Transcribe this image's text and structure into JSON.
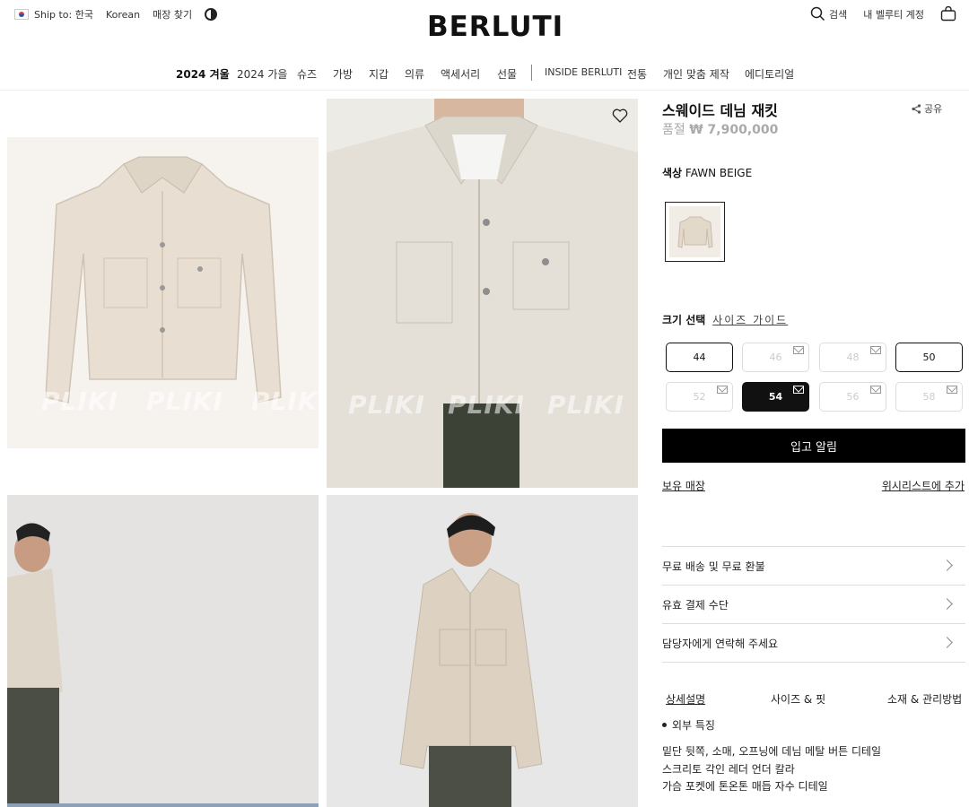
{
  "topbar": {
    "ship_to": "Ship to: 한국",
    "language": "Korean",
    "store_finder": "매장 찾기",
    "logo": "BERLUTI",
    "search": "검색",
    "account": "내 벨루티 계정"
  },
  "nav": {
    "items": [
      "2024 겨울",
      "2024 가을",
      "슈즈",
      "가방",
      "지갑",
      "의류",
      "액세서리",
      "선물",
      "INSIDE BERLUTI",
      "전통",
      "개인 맞춤 제작",
      "에디토리얼"
    ]
  },
  "gallery": {
    "watermark": "PLIKI"
  },
  "product": {
    "name": "스웨이드 데님 재킷",
    "share": "공유",
    "price_status": "품절",
    "price": "₩ 7,900,000",
    "color_label": "색상",
    "color_value": "FAWN BEIGE",
    "size_label": "크기 선택",
    "size_guide": "사이즈 가이드",
    "sizes": [
      {
        "label": "44",
        "state": "available"
      },
      {
        "label": "46",
        "state": "unavailable"
      },
      {
        "label": "48",
        "state": "unavailable"
      },
      {
        "label": "50",
        "state": "available"
      },
      {
        "label": "52",
        "state": "unavailable"
      },
      {
        "label": "54",
        "state": "selected"
      },
      {
        "label": "56",
        "state": "unavailable"
      },
      {
        "label": "58",
        "state": "unavailable"
      }
    ],
    "notify_button": "입고 알림",
    "store_stock": "보유 매장",
    "wishlist": "위시리스트에 추가",
    "accordion": [
      "무료 배송 및 무료 환불",
      "유효 결제 수단",
      "담당자에게 연락해 주세요"
    ],
    "tabs": [
      "상세설명",
      "사이즈 & 핏",
      "소재 & 관리방법"
    ],
    "bullet": "외부 특징",
    "desc_lines": [
      "밑단 뒷쪽, 소매, 오프닝에 데님 메탈 버튼 디테일",
      "스크리토 각인 레더 언더 칼라",
      "가슴 포켓에 톤온톤 매듭 자수 디테일"
    ]
  },
  "colors": {
    "accent": "#000000",
    "jacket": "#e6ddd0",
    "unavailable_text": "#cccccc"
  }
}
